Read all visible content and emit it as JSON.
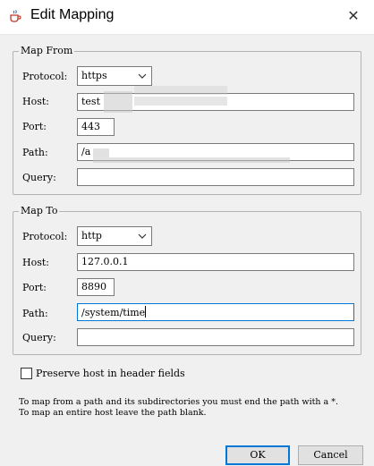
{
  "window": {
    "title": "Edit Mapping",
    "app_icon": "java-coffee-cup-icon",
    "close_icon": "close-icon",
    "close_glyph": "✕"
  },
  "map_from": {
    "legend": "Map From",
    "protocol": {
      "label": "Protocol:",
      "value": "https"
    },
    "host": {
      "label": "Host:",
      "value": "test"
    },
    "port": {
      "label": "Port:",
      "value": "443"
    },
    "path": {
      "label": "Path:",
      "value": "/a"
    },
    "query": {
      "label": "Query:",
      "value": ""
    }
  },
  "map_to": {
    "legend": "Map To",
    "protocol": {
      "label": "Protocol:",
      "value": "http"
    },
    "host": {
      "label": "Host:",
      "value": "127.0.0.1"
    },
    "port": {
      "label": "Port:",
      "value": "8890"
    },
    "path": {
      "label": "Path:",
      "value": "/system/time"
    },
    "query": {
      "label": "Query:",
      "value": ""
    }
  },
  "preserve_host": {
    "label": "Preserve host in header fields",
    "checked": false
  },
  "help": {
    "line1": "To map from a path and its subdirectories you must end the path with a *.",
    "line2": "To map an entire host leave the path blank."
  },
  "buttons": {
    "ok": "OK",
    "cancel": "Cancel"
  },
  "colors": {
    "background": "#f0f0f0",
    "focus_border": "#0078d7",
    "redaction": "#c8c8c8"
  }
}
